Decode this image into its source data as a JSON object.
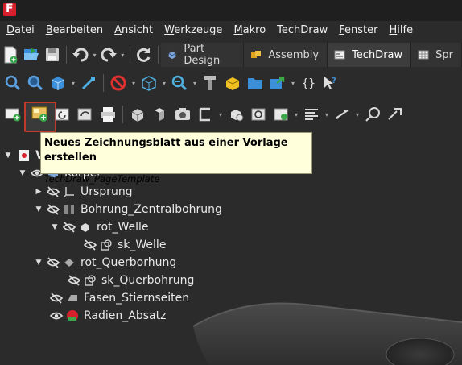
{
  "menubar": {
    "items": [
      {
        "u": "D",
        "rest": "atei"
      },
      {
        "u": "B",
        "rest": "earbeiten"
      },
      {
        "u": "A",
        "rest": "nsicht"
      },
      {
        "u": "W",
        "rest": "erkzeuge"
      },
      {
        "u": "M",
        "rest": "akro"
      },
      {
        "u": "",
        "rest": "TechDraw"
      },
      {
        "u": "F",
        "rest": "enster"
      },
      {
        "u": "H",
        "rest": "ilfe"
      }
    ]
  },
  "workbench_tabs": [
    {
      "label": "Part Design",
      "active": false
    },
    {
      "label": "Assembly",
      "active": false
    },
    {
      "label": "TechDraw",
      "active": true
    },
    {
      "label": "Spr",
      "active": false
    }
  ],
  "tooltip": {
    "title": "Neues Zeichnungsblatt aus einer Vorlage erstellen",
    "command": "TechDraw_PageTemplate"
  },
  "tree": {
    "root_label": "V",
    "items": [
      {
        "label": "Körper"
      },
      {
        "label": "Ursprung"
      },
      {
        "label": "Bohrung_Zentralbohrung"
      },
      {
        "label": "rot_Welle"
      },
      {
        "label": "sk_Welle"
      },
      {
        "label": "rot_Querborhung"
      },
      {
        "label": "sk_Querbohrung"
      },
      {
        "label": "Fasen_Stiernseiten"
      },
      {
        "label": "Radien_Absatz"
      }
    ]
  },
  "colors": {
    "background": "#2b2b2b",
    "tooltip_bg": "#ffffdc",
    "highlight": "#c0392b",
    "accent_blue": "#3b8fd9",
    "accent_green": "#3aa84a"
  }
}
